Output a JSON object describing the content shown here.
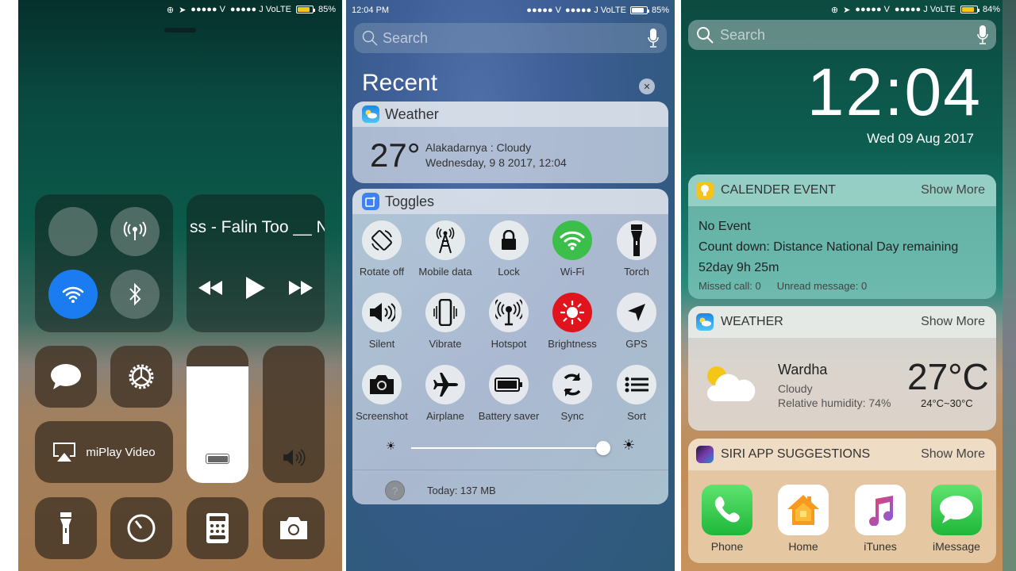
{
  "left_panel": {
    "status_bar": {
      "carrier1": "●●●●● V",
      "carrier2": "●●●●● J VoLTE",
      "battery": "85%",
      "battery_level": 0.85
    },
    "connectivity": {
      "airplane_on": false,
      "cellular_on": false,
      "wifi_on": true,
      "bluetooth_on": false
    },
    "media": {
      "song_title": "ss - Falin Too __ N"
    },
    "screen_mirroring_label": "miPlay Video",
    "brightness_level": 0.85,
    "volume_level": 0.0,
    "accent_blue": "#1a7cf0"
  },
  "middle_panel": {
    "status_bar": {
      "time": "12:04 PM",
      "carrier1": "●●●●● V",
      "carrier2": "●●●●● J VoLTE",
      "battery": "85%"
    },
    "search": {
      "placeholder": "Search"
    },
    "section_title": "Recent",
    "weather": {
      "title": "Weather",
      "temperature": "27°",
      "location_condition": "Alakadarnya : Cloudy",
      "datetime": "Wednesday, 9 8 2017, 12:04"
    },
    "toggles": {
      "title": "Toggles",
      "items": [
        {
          "label": "Rotate off",
          "icon": "rotate-icon",
          "active": false
        },
        {
          "label": "Mobile data",
          "icon": "mobile-data-icon",
          "active": false
        },
        {
          "label": "Lock",
          "icon": "lock-icon",
          "active": false
        },
        {
          "label": "Wi-Fi",
          "icon": "wifi-icon",
          "active": true,
          "color": "#3cbf4a"
        },
        {
          "label": "Torch",
          "icon": "torch-icon",
          "active": false
        },
        {
          "label": "Silent",
          "icon": "speaker-icon",
          "active": false
        },
        {
          "label": "Vibrate",
          "icon": "vibrate-icon",
          "active": false
        },
        {
          "label": "Hotspot",
          "icon": "hotspot-icon",
          "active": false
        },
        {
          "label": "Brightness",
          "icon": "brightness-icon",
          "active": true,
          "color": "#e0141c"
        },
        {
          "label": "GPS",
          "icon": "gps-icon",
          "active": false
        },
        {
          "label": "Screenshot",
          "icon": "camera-icon",
          "active": false
        },
        {
          "label": "Airplane",
          "icon": "airplane-icon",
          "active": false
        },
        {
          "label": "Battery saver",
          "icon": "battery-icon",
          "active": false
        },
        {
          "label": "Sync",
          "icon": "sync-icon",
          "active": false
        },
        {
          "label": "Sort",
          "icon": "list-icon",
          "active": false
        }
      ],
      "brightness_slider": 0.93,
      "data_usage": "Today: 137 MB",
      "help_icon": "?"
    }
  },
  "right_panel": {
    "status_bar": {
      "carrier1": "●●●●● V",
      "carrier2": "●●●●● J VoLTE",
      "battery": "84%"
    },
    "search": {
      "placeholder": "Search"
    },
    "clock": {
      "time": "12:04",
      "date": "Wed 09 Aug 2017"
    },
    "calendar": {
      "title": "CALENDER EVENT",
      "show_more": "Show More",
      "line1": "No Event",
      "line2": "Count down: Distance National Day remaining",
      "line3": "52day 9h 25m",
      "missed_call": "Missed call: 0",
      "unread_message": "Unread message: 0"
    },
    "weather": {
      "title": "WEATHER",
      "show_more": "Show More",
      "city": "Wardha",
      "condition": "Cloudy",
      "humidity": "Relative humidity: 74%",
      "temperature": "27°C",
      "range": "24°C~30°C"
    },
    "siri": {
      "title": "SIRI APP SUGGESTIONS",
      "show_more": "Show More",
      "apps": [
        {
          "label": "Phone",
          "icon": "phone-app-icon"
        },
        {
          "label": "Home",
          "icon": "home-app-icon"
        },
        {
          "label": "iTunes",
          "icon": "itunes-app-icon"
        },
        {
          "label": "iMessage",
          "icon": "imessage-app-icon"
        }
      ]
    }
  }
}
